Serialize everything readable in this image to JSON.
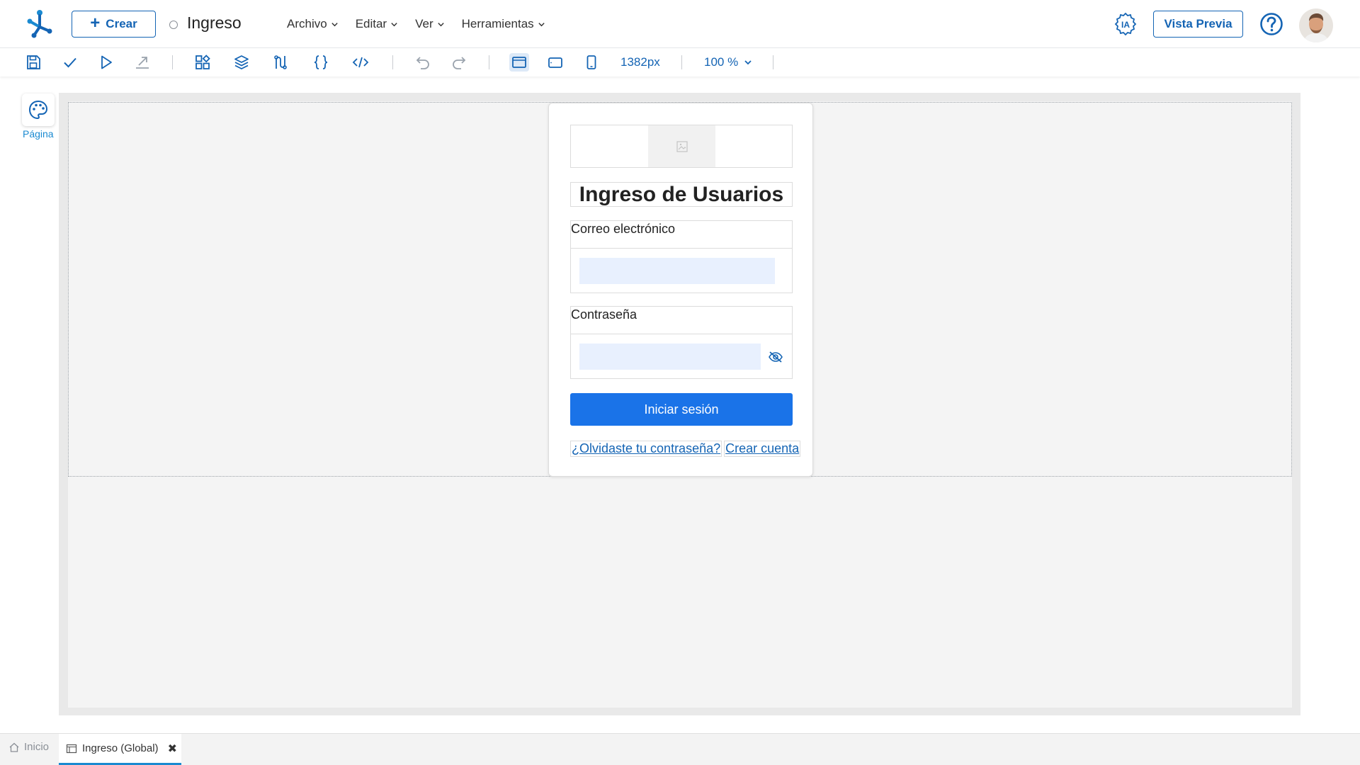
{
  "header": {
    "create_label": "Crear",
    "doc_title": "Ingreso",
    "menu": [
      {
        "label": "Archivo"
      },
      {
        "label": "Editar"
      },
      {
        "label": "Ver"
      },
      {
        "label": "Herramientas"
      }
    ],
    "ia_label": "IA",
    "preview_label": "Vista Previa"
  },
  "toolbar": {
    "width_value": "1382px",
    "zoom_value": "100 %"
  },
  "side_panel": {
    "page_label": "Página"
  },
  "login_form": {
    "title": "Ingreso de Usuarios",
    "email_label": "Correo electrónico",
    "email_value": "",
    "password_label": "Contraseña",
    "password_value": "",
    "login_button": "Iniciar sesión",
    "forgot_link": "¿Olvidaste tu contraseña?",
    "create_account_link": "Crear cuenta"
  },
  "bottom_tabs": [
    {
      "label": "Inicio"
    },
    {
      "label": "Ingreso (Global)"
    }
  ],
  "colors": {
    "accent": "#1464b4",
    "primary_button": "#1a73e8",
    "input_fill": "#e8f0fe",
    "canvas_bg": "#f4f4f4"
  }
}
